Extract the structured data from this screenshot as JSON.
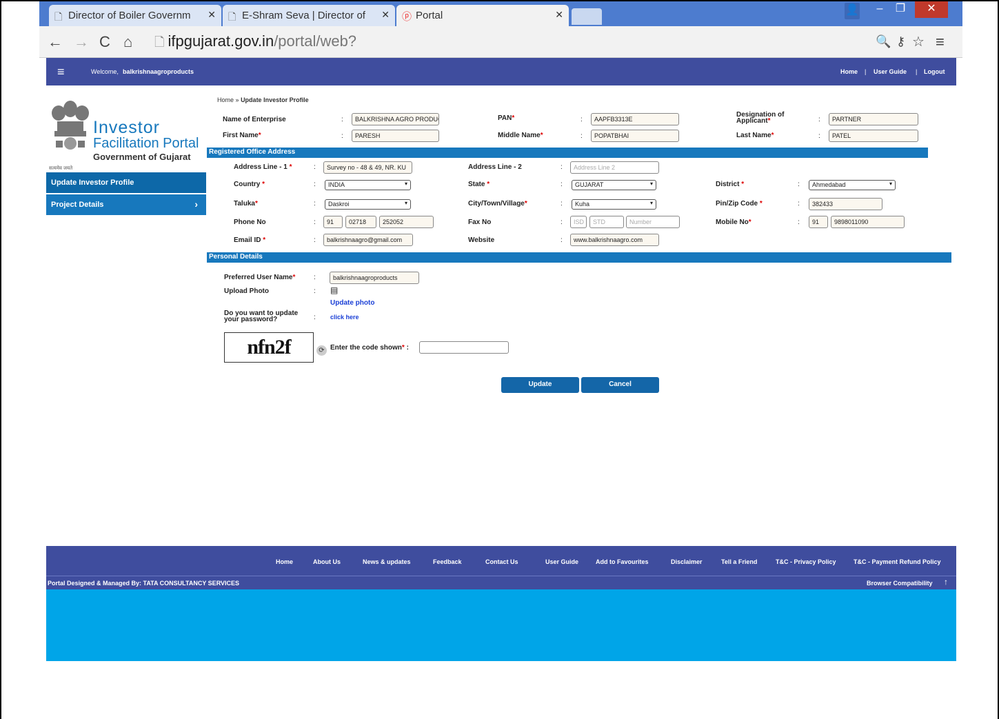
{
  "browser": {
    "tabs": [
      {
        "title": "Director of Boiler Governm",
        "icon": "document-icon"
      },
      {
        "title": "E-Shram Seva | Director of",
        "icon": "document-icon"
      },
      {
        "title": "Portal",
        "icon": "portal-icon"
      }
    ],
    "address": {
      "host": "ifpgujarat.gov.in",
      "path": "/portal/web?"
    }
  },
  "header": {
    "welcome": "Welcome,",
    "username": "balkrishnaagroproducts",
    "links": [
      "Home",
      "User Guide",
      "Logout"
    ]
  },
  "logo": {
    "line1": "Investor",
    "line2": "Facilitation Portal",
    "line3": "Government of Gujarat",
    "motto": "सत्यमेव जयते"
  },
  "sidebar": {
    "items": [
      {
        "label": "Update Investor Profile"
      },
      {
        "label": "Project Details",
        "chevron": "›"
      }
    ]
  },
  "breadcrumb": {
    "home": "Home",
    "sep": "»",
    "current": "Update Investor Profile"
  },
  "profile": {
    "enterprise_label": "Name of Enterprise",
    "enterprise_value": "BALKRISHNA AGRO PRODUCTS",
    "pan_label": "PAN",
    "pan_value": "AAPFB3313E",
    "designation_label_1": "Designation of",
    "designation_label_2": "Applicant",
    "designation_value": "PARTNER",
    "first_label": "First Name",
    "first_value": "PARESH",
    "middle_label": "Middle Name",
    "middle_value": "POPATBHAI",
    "last_label": "Last Name",
    "last_value": "PATEL"
  },
  "address": {
    "section": "Registered Office Address",
    "line1_label": "Address Line - 1",
    "line1_value": "Survey no - 48 & 49, NR. KU",
    "line2_label": "Address Line - 2",
    "line2_placeholder": "Address Line 2",
    "country_label": "Country",
    "country_value": "INDIA",
    "state_label": "State",
    "state_value": "GUJARAT",
    "district_label": "District",
    "district_value": "Ahmedabad",
    "taluka_label": "Taluka",
    "taluka_value": "Daskroi",
    "city_label": "City/Town/Village",
    "city_value": "Kuha",
    "pin_label": "Pin/Zip Code",
    "pin_value": "382433",
    "phone_label": "Phone No",
    "phone_cc": "91",
    "phone_std": "02718",
    "phone_num": "252052",
    "fax_label": "Fax No",
    "fax_isd": "ISD",
    "fax_std": "STD",
    "fax_num": "Number",
    "mobile_label": "Mobile No",
    "mobile_cc": "91",
    "mobile_num": "9898011090",
    "email_label": "Email ID",
    "email_value": "balkrishnaagro@gmail.com",
    "website_label": "Website",
    "website_value": "www.balkrishnaagro.com"
  },
  "personal": {
    "section": "Personal Details",
    "username_label": "Preferred User Name",
    "username_value": "balkrishnaagroproducts",
    "photo_label": "Upload Photo",
    "photo_link": "Update photo",
    "password_label_1": "Do you want to update",
    "password_label_2": "your password?",
    "password_link": "click here"
  },
  "captcha": {
    "code": "nfn2f",
    "label": "Enter the code shown"
  },
  "actions": {
    "update": "Update",
    "cancel": "Cancel"
  },
  "footer": {
    "links": [
      "Home",
      "About Us",
      "News & updates",
      "Feedback",
      "Contact Us",
      "User Guide",
      "Add to Favourites",
      "Disclaimer",
      "Tell a Friend",
      "T&C - Privacy Policy",
      "T&C - Payment Refund Policy"
    ],
    "credit": "Portal Designed & Managed By: TATA CONSULTANCY SERVICES",
    "compat": "Browser Compatibility",
    "arrow": "↑"
  },
  "colors": {
    "header": "#3f4d9e",
    "section": "#1778bd",
    "button": "#1466a8",
    "bottom": "#00a5e8"
  }
}
